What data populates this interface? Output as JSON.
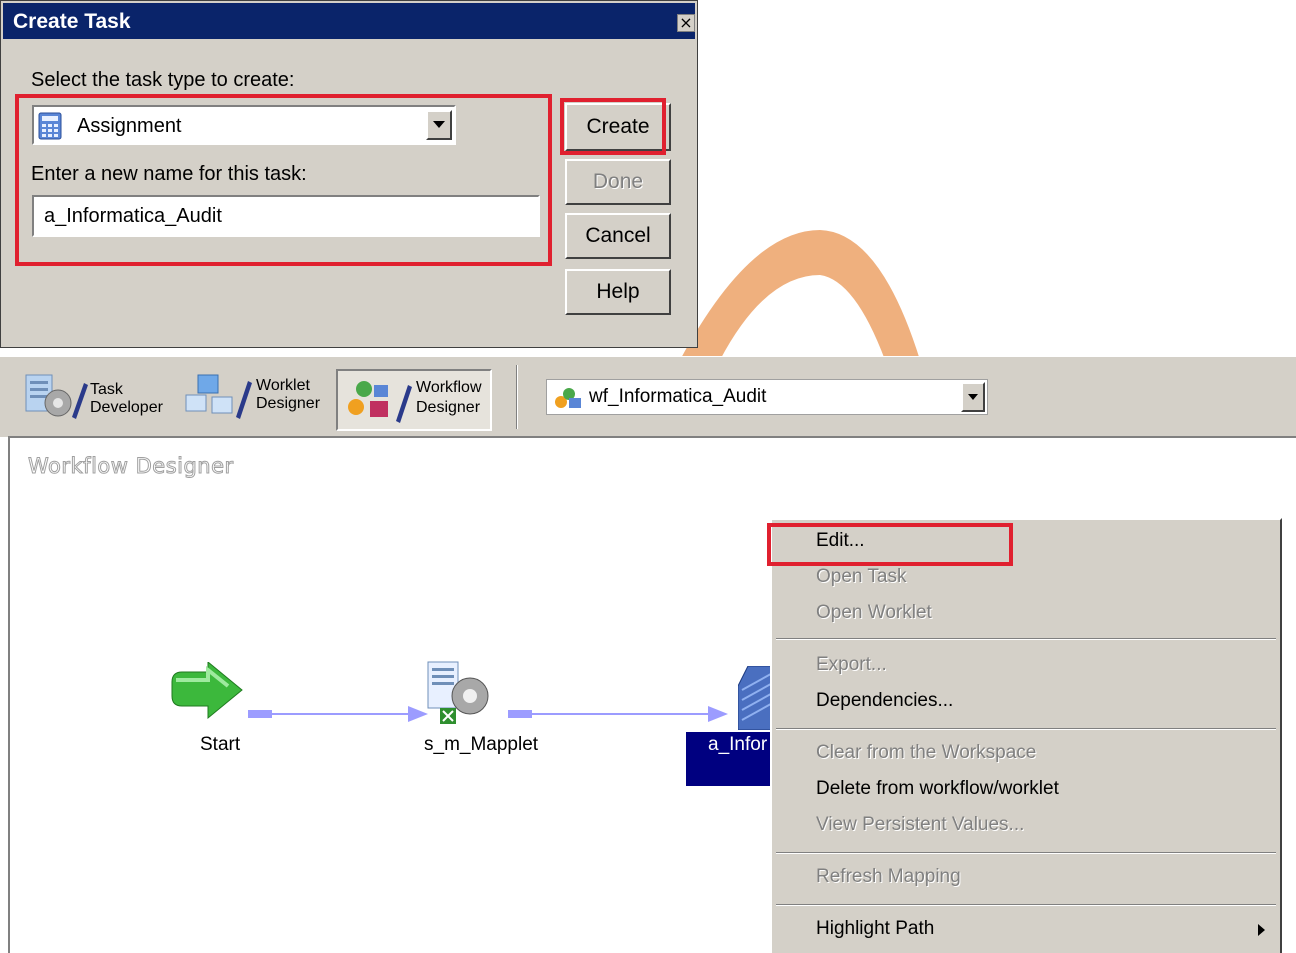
{
  "dialog": {
    "title": "Create Task",
    "close_glyph": "×",
    "task_type_label": "Select the task type to create:",
    "selected_task_type": "Assignment",
    "name_label": "Enter a new name for this task:",
    "name_value": "a_Informatica_Audit",
    "buttons": {
      "create": "Create",
      "done": "Done",
      "cancel": "Cancel",
      "help": "Help"
    }
  },
  "toolbar": {
    "task_developer": [
      "Task",
      "Developer"
    ],
    "worklet_designer": [
      "Worklet",
      "Designer"
    ],
    "workflow_designer": [
      "Workflow",
      "Designer"
    ],
    "workflow_select": "wf_Informatica_Audit"
  },
  "canvas": {
    "title": "Workflow Designer",
    "nodes": {
      "start": "Start",
      "session": "s_m_Mapplet",
      "assignment": "a_Infor"
    }
  },
  "context_menu": {
    "items": [
      {
        "label": "Edit...",
        "enabled": true
      },
      {
        "label": "Open Task",
        "enabled": false
      },
      {
        "label": "Open Worklet",
        "enabled": false
      },
      {
        "label": "Export...",
        "enabled": false
      },
      {
        "label": "Dependencies...",
        "enabled": true
      },
      {
        "label": "Clear from the Workspace",
        "enabled": false
      },
      {
        "label": "Delete from workflow/worklet",
        "enabled": true
      },
      {
        "label": "View Persistent Values...",
        "enabled": false
      },
      {
        "label": "Refresh Mapping",
        "enabled": false
      },
      {
        "label": "Highlight Path",
        "enabled": true
      }
    ]
  },
  "colors": {
    "titlebar": "#0a246a",
    "highlight_red": "#e0202f",
    "selected_node": "#000080",
    "watermark": "#efb07e",
    "link": "#9c9cff"
  }
}
